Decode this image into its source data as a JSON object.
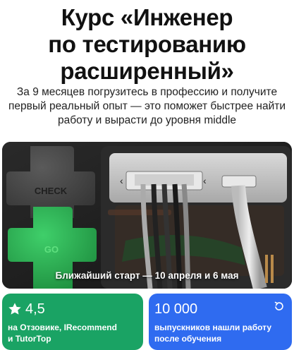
{
  "header": {
    "title_lines": [
      "Курс «Инженер",
      "по тестированию",
      "расширенный»"
    ],
    "subtitle_lines": [
      "За 9 месяцев погрузитесь в профессию и получите",
      "первый реальный опыт — это поможет быстрее найти",
      "работу и вырасти до уровня middle"
    ]
  },
  "hero": {
    "keycap_check_label": "CHECK",
    "keycap_go_label": "GO",
    "caption": "Ближайший старт — 10 апреля и 6 мая"
  },
  "stats": {
    "rating": {
      "value": "4,5",
      "icon": "star-icon",
      "desc_lines": [
        "на Отзовике, IRecommend",
        "и TutorTop"
      ],
      "color": "#1aa364"
    },
    "graduates": {
      "value": "10 000",
      "icon": "refresh-icon",
      "desc_lines": [
        "выпускников нашли работу",
        "после обучения"
      ],
      "color": "#2f6bf0"
    }
  }
}
